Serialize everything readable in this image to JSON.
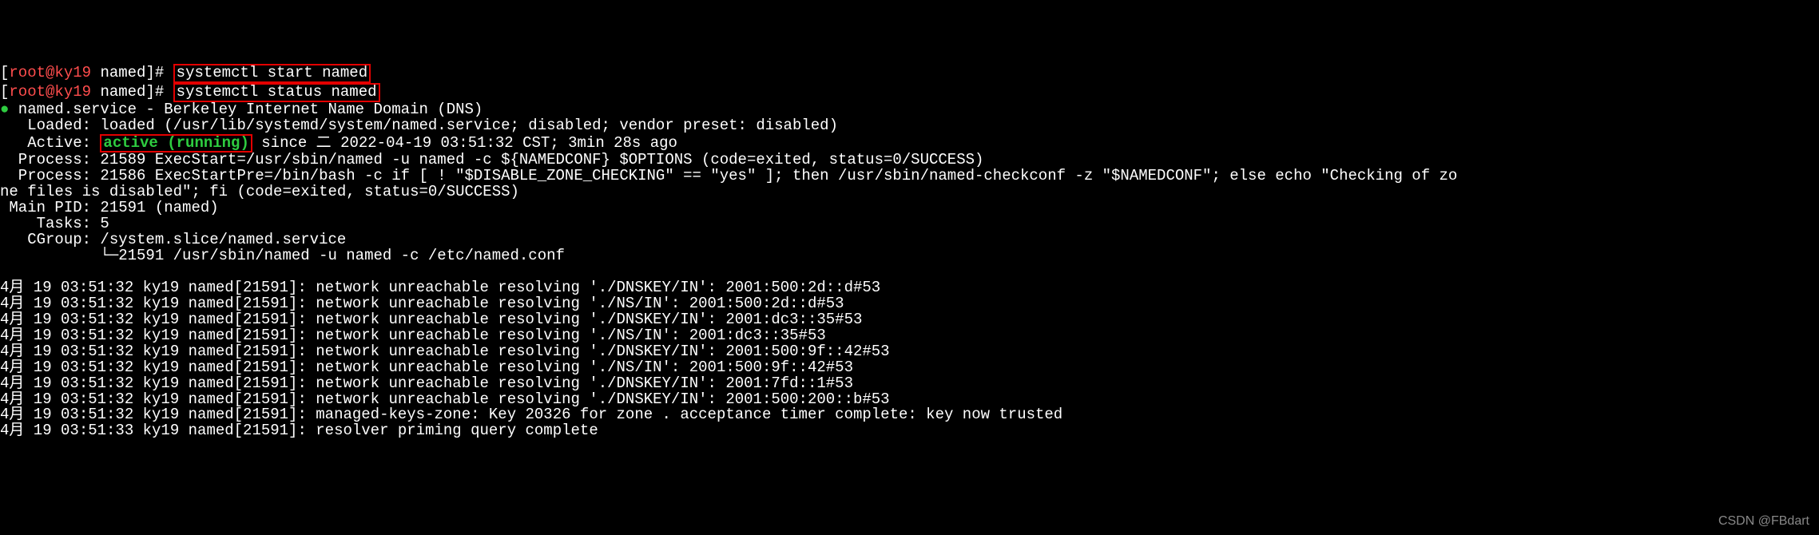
{
  "prompt": {
    "user": "root",
    "host": "ky19",
    "path": "named",
    "open": "[",
    "at": "@",
    "close": "]",
    "hash": "#"
  },
  "commands": {
    "start": "systemctl start named",
    "status": "systemctl status named"
  },
  "status": {
    "bullet": "●",
    "unit_line": " named.service - Berkeley Internet Name Domain (DNS)",
    "loaded": "   Loaded: loaded (/usr/lib/systemd/system/named.service; disabled; vendor preset: disabled)",
    "active_label": "   Active: ",
    "active_value": "active (running)",
    "active_since": " since 二 2022-04-19 03:51:32 CST; 3min 28s ago",
    "process1": "  Process: 21589 ExecStart=/usr/sbin/named -u named -c ${NAMEDCONF} $OPTIONS (code=exited, status=0/SUCCESS)",
    "process2": "  Process: 21586 ExecStartPre=/bin/bash -c if [ ! \"$DISABLE_ZONE_CHECKING\" == \"yes\" ]; then /usr/sbin/named-checkconf -z \"$NAMEDCONF\"; else echo \"Checking of zo\nne files is disabled\"; fi (code=exited, status=0/SUCCESS)",
    "mainpid": " Main PID: 21591 (named)",
    "tasks": "    Tasks: 5",
    "cgroup": "   CGroup: /system.slice/named.service",
    "cgroup_child": "           └─21591 /usr/sbin/named -u named -c /etc/named.conf"
  },
  "logs": [
    "4月 19 03:51:32 ky19 named[21591]: network unreachable resolving './DNSKEY/IN': 2001:500:2d::d#53",
    "4月 19 03:51:32 ky19 named[21591]: network unreachable resolving './NS/IN': 2001:500:2d::d#53",
    "4月 19 03:51:32 ky19 named[21591]: network unreachable resolving './DNSKEY/IN': 2001:dc3::35#53",
    "4月 19 03:51:32 ky19 named[21591]: network unreachable resolving './NS/IN': 2001:dc3::35#53",
    "4月 19 03:51:32 ky19 named[21591]: network unreachable resolving './DNSKEY/IN': 2001:500:9f::42#53",
    "4月 19 03:51:32 ky19 named[21591]: network unreachable resolving './NS/IN': 2001:500:9f::42#53",
    "4月 19 03:51:32 ky19 named[21591]: network unreachable resolving './DNSKEY/IN': 2001:7fd::1#53",
    "4月 19 03:51:32 ky19 named[21591]: network unreachable resolving './DNSKEY/IN': 2001:500:200::b#53",
    "4月 19 03:51:32 ky19 named[21591]: managed-keys-zone: Key 20326 for zone . acceptance timer complete: key now trusted",
    "4月 19 03:51:33 ky19 named[21591]: resolver priming query complete"
  ],
  "watermark": "CSDN @FBdart"
}
